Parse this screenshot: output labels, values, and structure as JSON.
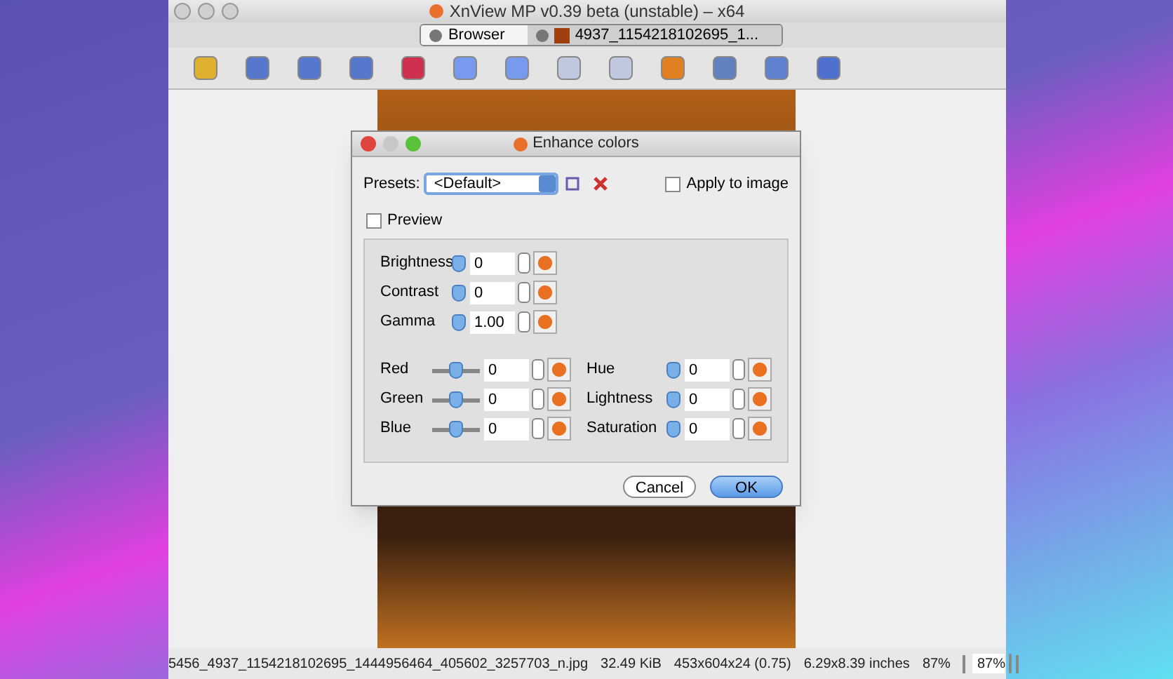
{
  "window": {
    "title": "XnView MP v0.39 beta (unstable) – x64"
  },
  "tabs": [
    {
      "label": "Browser",
      "selected": false
    },
    {
      "label": "4937_1154218102695_1...",
      "selected": true
    }
  ],
  "dialog": {
    "title": "Enhance colors",
    "presets_label": "Presets:",
    "preset_value": "<Default>",
    "apply_to_image": {
      "label": "Apply to image",
      "checked": false
    },
    "preview": {
      "label": "Preview",
      "checked": false
    },
    "left_controls": [
      {
        "label": "Brightness",
        "kind": "knob",
        "value": "0"
      },
      {
        "label": "Contrast",
        "kind": "knob",
        "value": "0"
      },
      {
        "label": "Gamma",
        "kind": "knob",
        "value": "1.00"
      }
    ],
    "color_controls": [
      {
        "label": "Red",
        "kind": "track",
        "level": 0.5,
        "value": "0"
      },
      {
        "label": "Green",
        "kind": "track",
        "level": 0.5,
        "value": "0"
      },
      {
        "label": "Blue",
        "kind": "track",
        "level": 0.5,
        "value": "0"
      }
    ],
    "hsl_controls": [
      {
        "label": "Hue",
        "kind": "knob",
        "value": "0"
      },
      {
        "label": "Lightness",
        "kind": "knob",
        "value": "0"
      },
      {
        "label": "Saturation",
        "kind": "knob",
        "value": "0"
      }
    ],
    "buttons": [
      "Cancel",
      "OK"
    ]
  },
  "status_bar": {
    "filename": "5456_4937_1154218102695_1444956464_405602_3257703_n.jpg",
    "size": "32.49 KiB",
    "dimensions": "453x604x24 (0.75)",
    "print_size": "6.29x8.39 inches",
    "zoom_percent": "87%",
    "zoom_value": "87%"
  }
}
